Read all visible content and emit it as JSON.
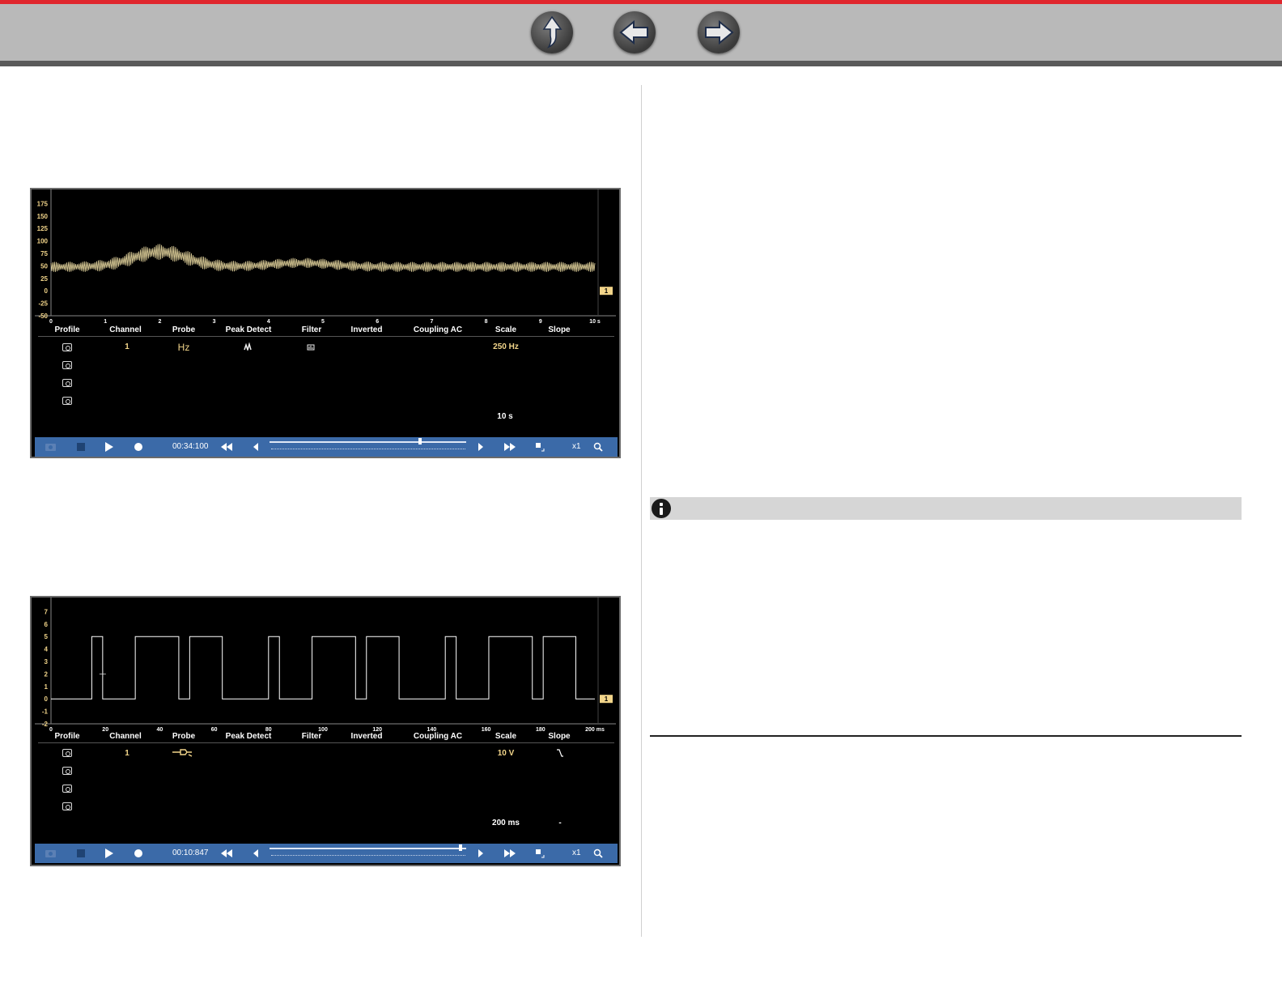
{
  "nav": {
    "buttons": [
      {
        "name": "up-arrow-icon"
      },
      {
        "name": "back-arrow-icon"
      },
      {
        "name": "forward-arrow-icon"
      }
    ],
    "colors": {
      "top_stripe": "#e0262d",
      "bar": "#b9b9b9",
      "bar_bottom": "#5a5a5a"
    }
  },
  "scope1": {
    "headers": [
      "Profile",
      "Channel",
      "Probe",
      "Peak Detect",
      "Filter",
      "Inverted",
      "Coupling AC",
      "Scale",
      "Slope"
    ],
    "row": {
      "channel": "1",
      "probe": "Hz",
      "scale": "250 Hz"
    },
    "timebase": "10 s",
    "toolbar": {
      "time": "00:34:100",
      "zoom": "x1"
    },
    "channel_marker": "1"
  },
  "scope2": {
    "headers": [
      "Profile",
      "Channel",
      "Probe",
      "Peak Detect",
      "Filter",
      "Inverted",
      "Coupling AC",
      "Scale",
      "Slope"
    ],
    "row": {
      "channel": "1",
      "scale": "10 V"
    },
    "timebase": "200 ms",
    "slope_bottom": "-",
    "toolbar": {
      "time": "00:10:847",
      "zoom": "x1"
    },
    "channel_marker": "1"
  },
  "chart_data": [
    {
      "type": "line",
      "series": [
        {
          "values": "oscillating frequency signal around 50 with a hump to ~80 near t=2 s"
        }
      ],
      "y_ticks": [
        "175",
        "150",
        "125",
        "100",
        "75",
        "50",
        "25",
        "0",
        "-25",
        "-50"
      ],
      "x_ticks": [
        "0",
        "1",
        "2",
        "3",
        "4",
        "5",
        "6",
        "7",
        "8",
        "9",
        "10 s"
      ],
      "xlim": [
        0,
        10
      ],
      "ylim": [
        -50,
        200
      ],
      "grid": false,
      "trace_color": "#e8d8a0"
    },
    {
      "type": "line",
      "y_ticks": [
        "7",
        "6",
        "5",
        "4",
        "3",
        "2",
        "1",
        "0",
        "-1",
        "-2"
      ],
      "x_ticks": [
        "0",
        "20",
        "40",
        "60",
        "80",
        "100",
        "120",
        "140",
        "160",
        "180",
        "200 ms"
      ],
      "xlim": [
        0,
        200
      ],
      "ylim": [
        -2,
        8
      ],
      "high_level": 5,
      "low_level": 0,
      "pulses": [
        [
          15,
          19
        ],
        [
          31,
          47
        ],
        [
          51,
          63
        ],
        [
          80,
          84
        ],
        [
          96,
          112
        ],
        [
          116,
          128
        ],
        [
          145,
          149
        ],
        [
          161,
          177
        ],
        [
          181,
          193
        ]
      ],
      "trace_color": "#ffffff"
    }
  ]
}
